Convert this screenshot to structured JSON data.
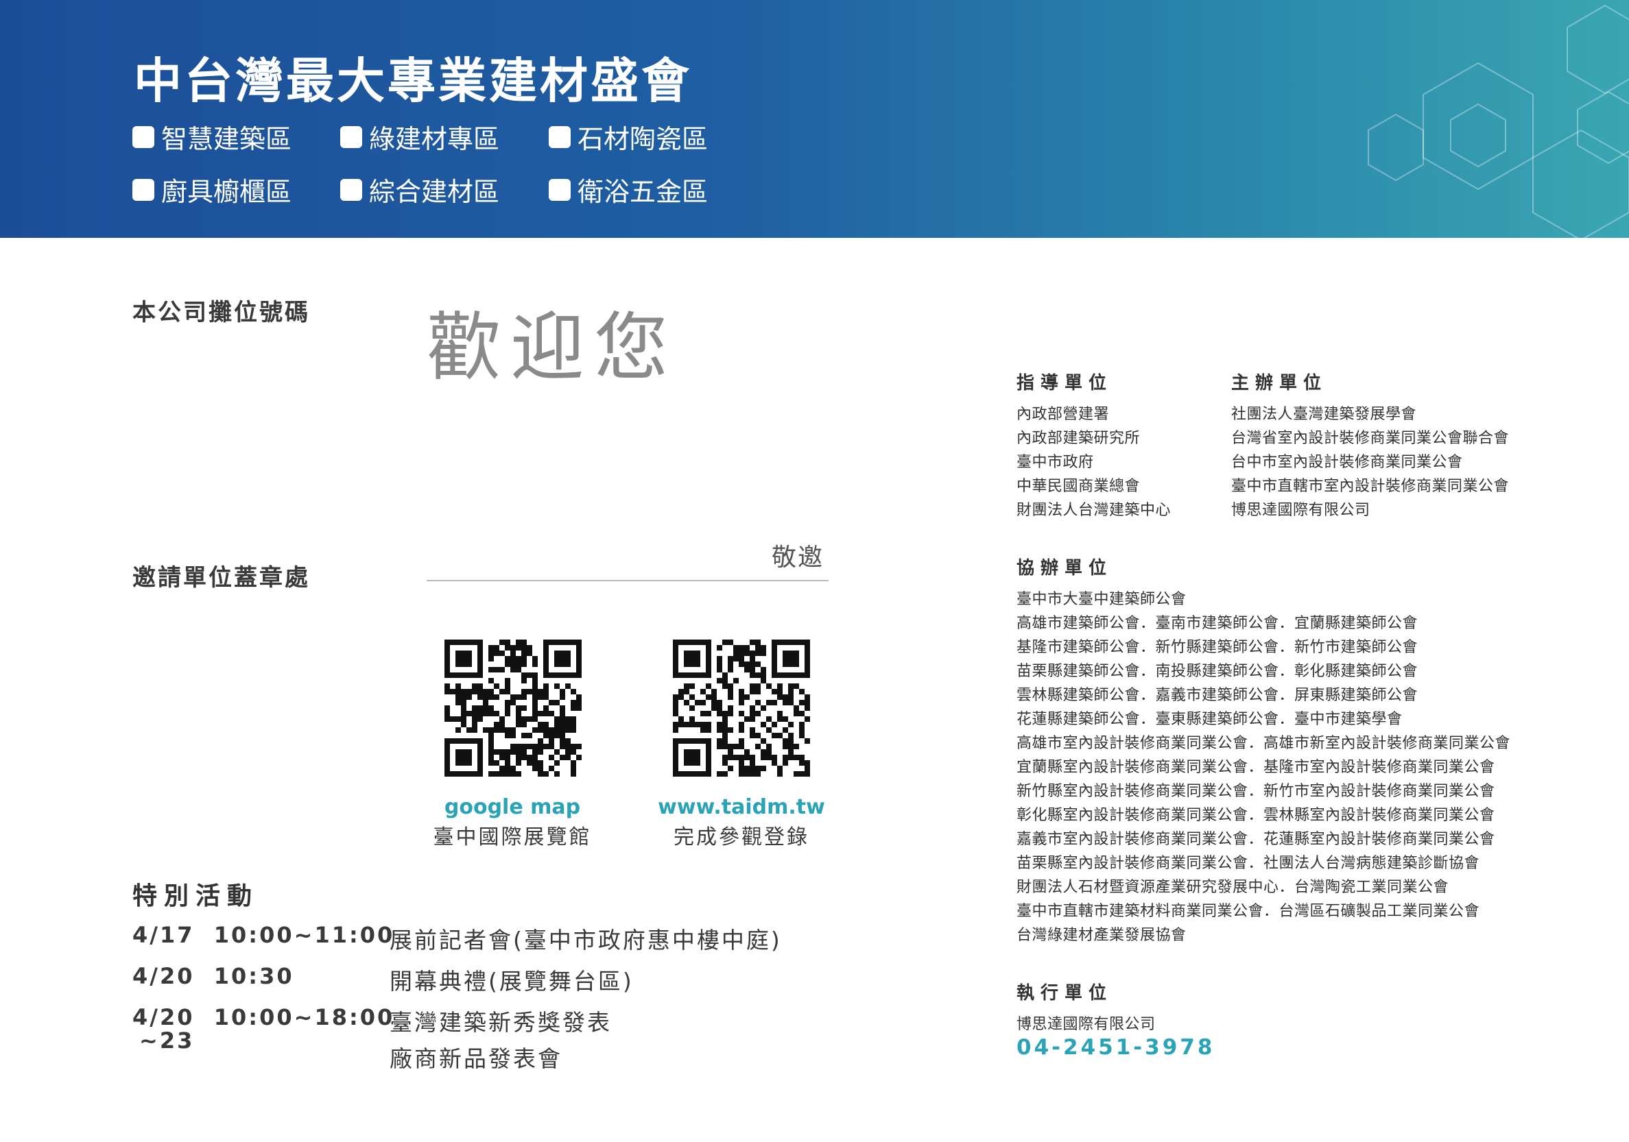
{
  "header": {
    "title": "中台灣最大專業建材盛會",
    "zones": [
      "智慧建築區",
      "綠建材專區",
      "石材陶瓷區",
      "廚具櫥櫃區",
      "綜合建材區",
      "衛浴五金區"
    ],
    "colors": {
      "banner_start": "#1c4e98",
      "banner_end": "#3aa6b2"
    }
  },
  "left": {
    "booth_label": "本公司攤位號碼",
    "welcome": "歡迎您",
    "stamp_label": "邀請單位蓋章處",
    "invite": "敬邀",
    "qr_codes": [
      {
        "en": "google map",
        "zh": "臺中國際展覽館",
        "icon": "qr-code-icon"
      },
      {
        "en": "www.taidm.tw",
        "zh": "完成參觀登錄",
        "icon": "qr-code-icon"
      }
    ],
    "activities": {
      "title": "特別活動",
      "items": [
        {
          "date": "4/17  10:00~11:00",
          "desc": "展前記者會(臺中市政府惠中樓中庭)"
        },
        {
          "date": "4/20  10:30",
          "desc": "開幕典禮(展覽舞台區)"
        },
        {
          "date": "4/20  10:00~18:00",
          "date2": "~23",
          "desc": "臺灣建築新秀獎發表",
          "desc2": "廠商新品發表會"
        }
      ]
    }
  },
  "right": {
    "guide": {
      "title": "指導單位",
      "items": [
        "內政部營建署",
        "內政部建築研究所",
        "臺中市政府",
        "中華民國商業總會",
        "財團法人台灣建築中心"
      ]
    },
    "host": {
      "title": "主辦單位",
      "items": [
        "社團法人臺灣建築發展學會",
        "台灣省室內設計裝修商業同業公會聯合會",
        "台中市室內設計裝修商業同業公會",
        "臺中市直轄市室內設計裝修商業同業公會",
        "博思達國際有限公司"
      ]
    },
    "co": {
      "title": "協辦單位",
      "items": [
        "臺中市大臺中建築師公會",
        "高雄市建築師公會．臺南市建築師公會．宜蘭縣建築師公會",
        "基隆市建築師公會．新竹縣建築師公會．新竹市建築師公會",
        "苗栗縣建築師公會．南投縣建築師公會．彰化縣建築師公會",
        "雲林縣建築師公會．嘉義市建築師公會．屏東縣建築師公會",
        "花蓮縣建築師公會．臺東縣建築師公會．臺中市建築學會",
        "高雄市室內設計裝修商業同業公會．高雄市新室內設計裝修商業同業公會",
        "宜蘭縣室內設計裝修商業同業公會．基隆市室內設計裝修商業同業公會",
        "新竹縣室內設計裝修商業同業公會．新竹市室內設計裝修商業同業公會",
        "彰化縣室內設計裝修商業同業公會．雲林縣室內設計裝修商業同業公會",
        "嘉義市室內設計裝修商業同業公會．花蓮縣室內設計裝修商業同業公會",
        "苗栗縣室內設計裝修商業同業公會．社團法人台灣病態建築診斷協會",
        "財團法人石材暨資源產業研究發展中心．台灣陶瓷工業同業公會",
        "臺中市直轄市建築材料商業同業公會．台灣區石礦製品工業同業公會",
        "台灣綠建材產業發展協會"
      ]
    },
    "exec": {
      "title": "執行單位",
      "company": "博思達國際有限公司",
      "phone": "04-2451-3978"
    }
  }
}
